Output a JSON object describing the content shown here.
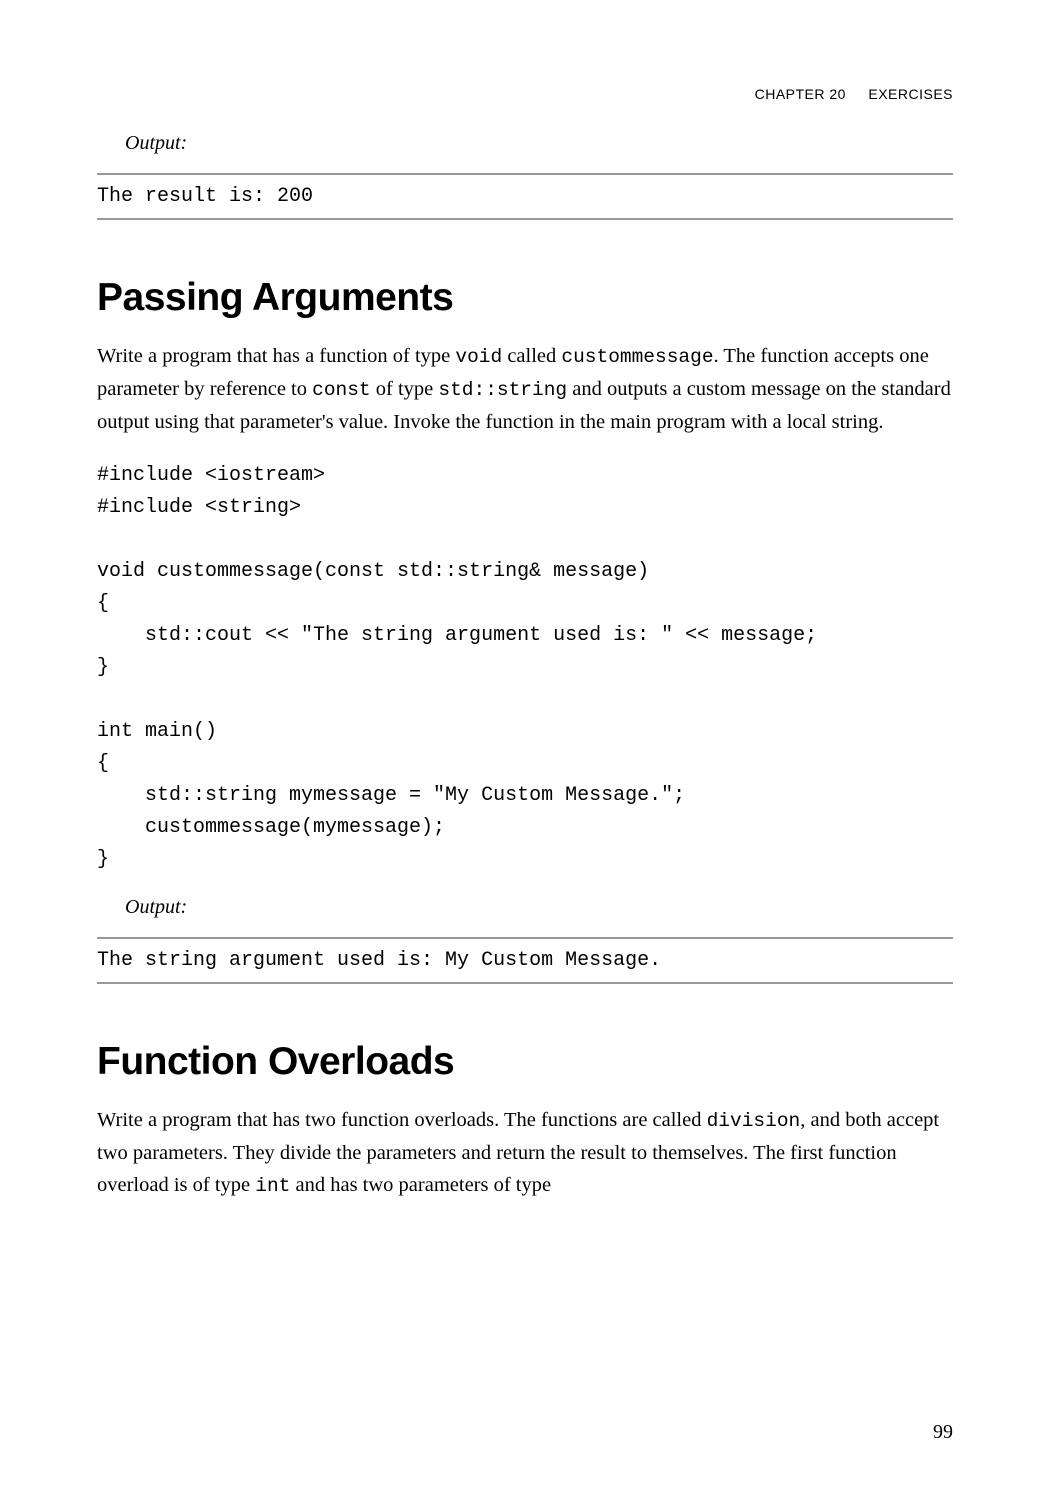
{
  "header": {
    "chapter": "CHAPTER 20",
    "title": "EXERCISES"
  },
  "section1": {
    "output_label": "Output:",
    "output_text": "The result is: 200"
  },
  "passing_args": {
    "heading": "Passing Arguments",
    "para_part1": "Write a program that has a function of type ",
    "code1": "void",
    "para_part2": " called ",
    "code2": "custommessage",
    "para_part3": ". The function accepts one parameter by reference to ",
    "code3": "const",
    "para_part4": " of type ",
    "code4": "std::string",
    "para_part5": " and outputs a custom message on the standard output using that parameter's value. Invoke the function in the main program with a local string.",
    "code_block": "#include <iostream>\n#include <string>\n\nvoid custommessage(const std::string& message)\n{\n    std::cout << \"The string argument used is: \" << message;\n}\n\nint main()\n{\n    std::string mymessage = \"My Custom Message.\";\n    custommessage(mymessage);\n}",
    "output_label": "Output:",
    "output_text": "The string argument used is: My Custom Message."
  },
  "func_overloads": {
    "heading": "Function Overloads",
    "para_part1": "Write a program that has two function overloads. The functions are called ",
    "code1": "division",
    "para_part2": ", and both accept two parameters. They divide the parameters and return the result to themselves. The first function overload is of type ",
    "code2": "int",
    "para_part3": " and has two parameters of type"
  },
  "page_number": "99"
}
